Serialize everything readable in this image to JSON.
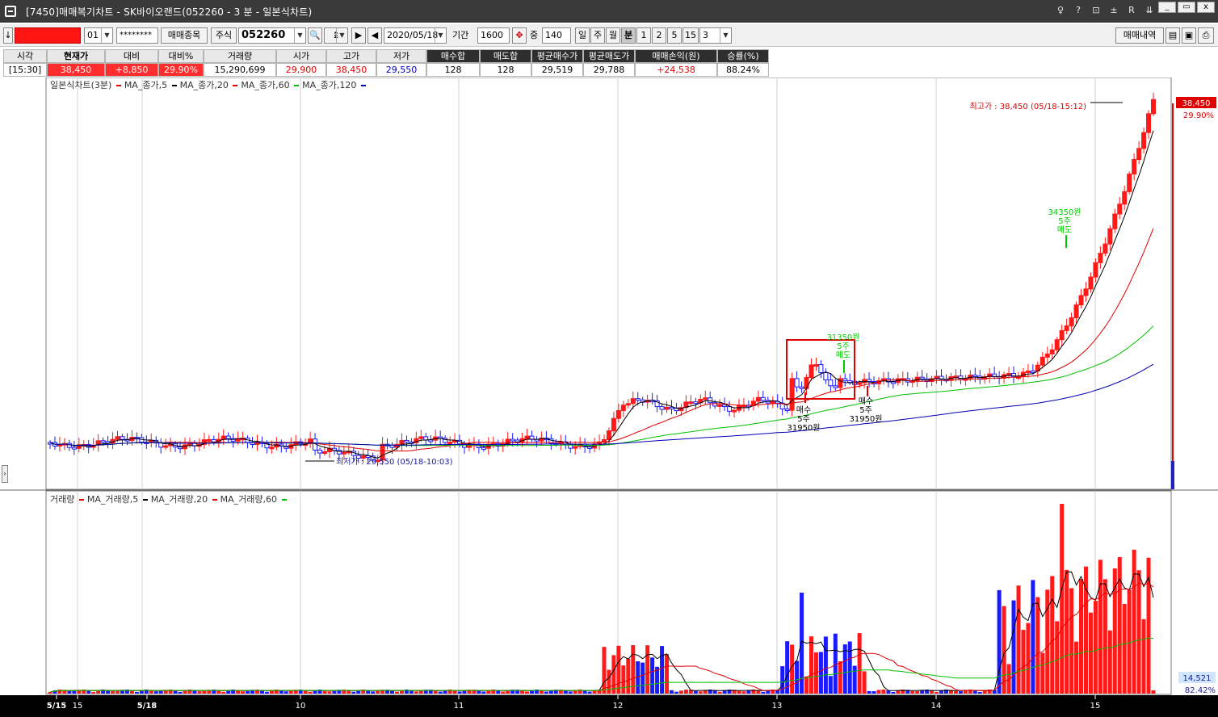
{
  "window": {
    "title": "[7450]매매복기차트 - SK바이오랜드(052260 - 3 분 - 일본식차트)",
    "tb_icons": [
      "♀",
      "?",
      "⊡",
      "±",
      "R",
      "⇊"
    ],
    "min": "_",
    "max": "▭",
    "close": "x"
  },
  "toolbar": {
    "arrow_down": "↓",
    "account_prefix": "01",
    "password": "********",
    "trade_item_btn": "매매종목",
    "type_select": "주식",
    "code": "052260",
    "date": "2020/05/18",
    "period_label": "기간",
    "period_value": "1600",
    "count_prefix": "중",
    "count_value": "140",
    "periods": [
      "일",
      "주",
      "월",
      "분",
      "1",
      "2",
      "5",
      "15"
    ],
    "active_period": "분",
    "interval": "3",
    "trade_history_btn": "매매내역"
  },
  "stats": {
    "headers": [
      "시각",
      "현재가",
      "대비",
      "대비%",
      "거래량",
      "시가",
      "고가",
      "저가",
      "매수합",
      "매도합",
      "평균매수가",
      "평균매도가",
      "매매손익(원)",
      "승률(%)"
    ],
    "values": [
      "[15:30]",
      "38,450",
      "+8,850",
      "29.90%",
      "15,290,699",
      "29,900",
      "38,450",
      "29,550",
      "128",
      "128",
      "29,519",
      "29,788",
      "+24,538",
      "88.24%"
    ]
  },
  "price_chart": {
    "legend_title": "일본식차트(3분)",
    "legend_items": [
      "MA_종가,5",
      "MA_종가,20",
      "MA_종가,60",
      "MA_종가,120"
    ],
    "high_label": "최고가 : 38,450 (05/18-15:12)",
    "low_label": "최저가 : 29,550 (05/18-10:03)",
    "last_price": "38,450",
    "last_pct": "29.90%",
    "buy1": [
      "매수",
      "5주",
      "31950원"
    ],
    "buy2": [
      "매수",
      "5주",
      "31950원"
    ],
    "sell1": [
      "31350원",
      "5주",
      "매도"
    ],
    "sell2": [
      "34350원",
      "5주",
      "매도"
    ]
  },
  "volume_chart": {
    "legend_title": "거래량",
    "legend_items": [
      "MA_거래량,5",
      "MA_거래량,20",
      "MA_거래량,60"
    ],
    "last_volume": "14,521",
    "last_pct": "82.42%"
  },
  "x_axis": {
    "labels": [
      "5/15",
      "15",
      "5/18",
      "10",
      "11",
      "12",
      "13",
      "14",
      "15"
    ]
  },
  "colors": {
    "up": "#ff1a1a",
    "down": "#1a1aff",
    "ma5": "#000000",
    "ma20": "#e00000",
    "ma60": "#00c000",
    "ma120": "#0000b0",
    "annot_buy": "#000000",
    "annot_sell": "#00cc00"
  }
}
